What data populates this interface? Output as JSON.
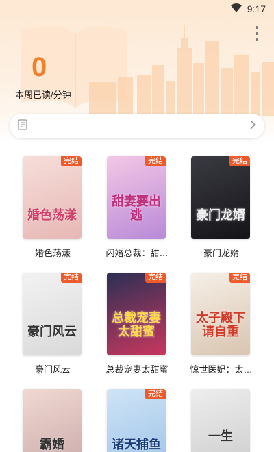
{
  "status_bar": {
    "time": "9:17"
  },
  "stats": {
    "value": "0",
    "label": "本周已读/分钟"
  },
  "search": {
    "placeholder": ""
  },
  "books": [
    {
      "title": "婚色荡漾",
      "cover_text": "婚色荡漾",
      "badge": "完结",
      "palette": [
        "#f6ded9",
        "#e7b7b5"
      ],
      "text_color": "#d1406a"
    },
    {
      "title": "闪婚总裁：甜…",
      "cover_text": "甜妻要出逃",
      "badge": "完结",
      "palette": [
        "#f3c7e5",
        "#b98ad8"
      ],
      "text_color": "#c0307a"
    },
    {
      "title": "豪门龙婿",
      "cover_text": "豪门龙婿",
      "badge": "完结",
      "palette": [
        "#3a3a42",
        "#141418"
      ],
      "text_color": "#f2f2f2"
    },
    {
      "title": "豪门风云",
      "cover_text": "豪门风云",
      "badge": "完结",
      "palette": [
        "#f2f2f2",
        "#d9d9d9"
      ],
      "text_color": "#333333"
    },
    {
      "title": "总裁宠妻太甜蜜",
      "cover_text": "总裁宠妻太甜蜜",
      "badge": "完结",
      "palette": [
        "#2b2f55",
        "#c9375e"
      ],
      "text_color": "#ffd84a"
    },
    {
      "title": "惊世医妃：太…",
      "cover_text": "太子殿下请自重",
      "badge": "完结",
      "palette": [
        "#f6efe6",
        "#d9c5b1"
      ],
      "text_color": "#d23a2a"
    },
    {
      "title": "",
      "cover_text": "霸婚",
      "badge": "",
      "palette": [
        "#f1d9d2",
        "#c9a9a9"
      ],
      "text_color": "#333333"
    },
    {
      "title": "",
      "cover_text": "诸天捕鱼",
      "badge": "完结",
      "palette": [
        "#cfe4f6",
        "#9cc2e8"
      ],
      "text_color": "#1a3c7a"
    },
    {
      "title": "",
      "cover_text": "一生",
      "badge": "",
      "palette": [
        "#eeeeee",
        "#cccccc"
      ],
      "text_color": "#333333"
    }
  ],
  "colors": {
    "accent": "#f0802a",
    "badge": "#ee5a2a"
  },
  "icons": {
    "signal": "wifi-signal-icon",
    "more": "more-vertical-icon",
    "search": "book-icon",
    "arrow": "chevron-right-icon"
  }
}
